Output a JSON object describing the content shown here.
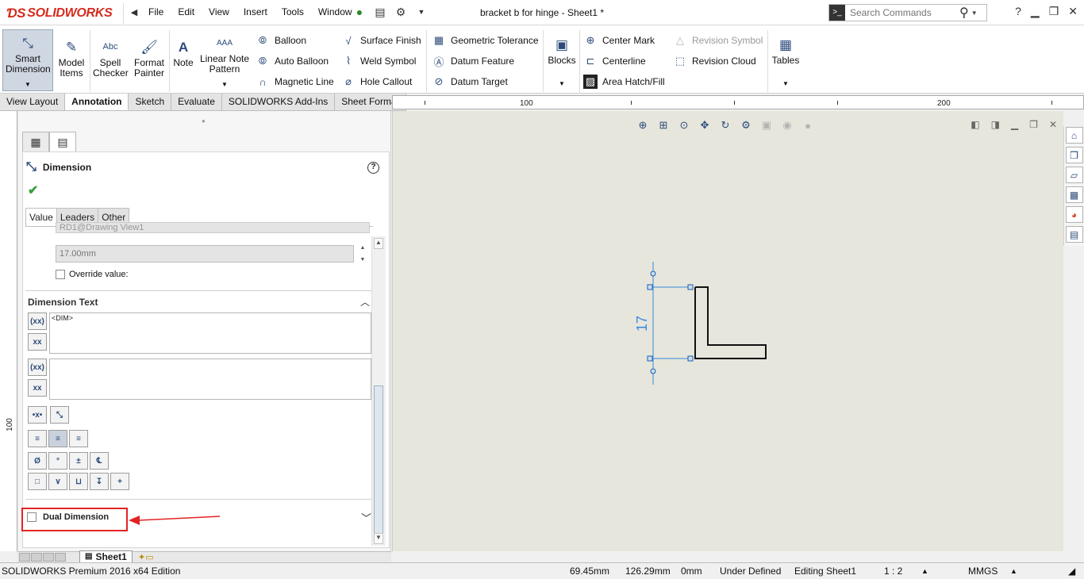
{
  "app": {
    "brand": "SOLIDWORKS",
    "document_title": "bracket b for hinge - Sheet1 *"
  },
  "menu": [
    "File",
    "Edit",
    "View",
    "Insert",
    "Tools",
    "Window"
  ],
  "search": {
    "placeholder": "Search Commands"
  },
  "ribbon": {
    "smart_dimension": "Smart Dimension",
    "model_items": "Model Items",
    "spell_checker": "Spell Checker",
    "format_painter": "Format Painter",
    "note": "Note",
    "linear_note_pattern": "Linear Note Pattern",
    "balloon": "Balloon",
    "auto_balloon": "Auto Balloon",
    "magnetic_line": "Magnetic Line",
    "surface_finish": "Surface Finish",
    "weld_symbol": "Weld Symbol",
    "hole_callout": "Hole Callout",
    "geometric_tolerance": "Geometric Tolerance",
    "datum_feature": "Datum Feature",
    "datum_target": "Datum Target",
    "blocks": "Blocks",
    "center_mark": "Center Mark",
    "centerline": "Centerline",
    "area_hatch_fill": "Area Hatch/Fill",
    "revision_symbol": "Revision Symbol",
    "revision_cloud": "Revision Cloud",
    "tables": "Tables"
  },
  "tabs": [
    "View Layout",
    "Annotation",
    "Sketch",
    "Evaluate",
    "SOLIDWORKS Add-Ins",
    "Sheet Format"
  ],
  "active_tab": "Annotation",
  "ruler": {
    "h_100": "100",
    "h_200": "200",
    "v_100": "100"
  },
  "property_manager": {
    "title": "Dimension",
    "subtabs": [
      "Value",
      "Leaders",
      "Other"
    ],
    "reference_field": "RD1@Drawing View1",
    "value_field": "17.00mm",
    "override_label": "Override value:",
    "dimension_text_title": "Dimension Text",
    "dim_text": "<DIM>",
    "dual_dimension_label": "Dual Dimension"
  },
  "sheet_tab": "Sheet1",
  "drawing": {
    "dimension_value": "17"
  },
  "status": {
    "edition": "SOLIDWORKS Premium 2016 x64 Edition",
    "x": "69.45mm",
    "y": "126.29mm",
    "z": "0mm",
    "state": "Under Defined",
    "editing": "Editing Sheet1",
    "scale": "1 : 2",
    "units": "MMGS"
  },
  "colors": {
    "brand_red": "#d52b1e",
    "dimension_blue": "#3b8ad9",
    "highlight_red": "#e32323",
    "canvas_bg": "#e6e6dc"
  }
}
